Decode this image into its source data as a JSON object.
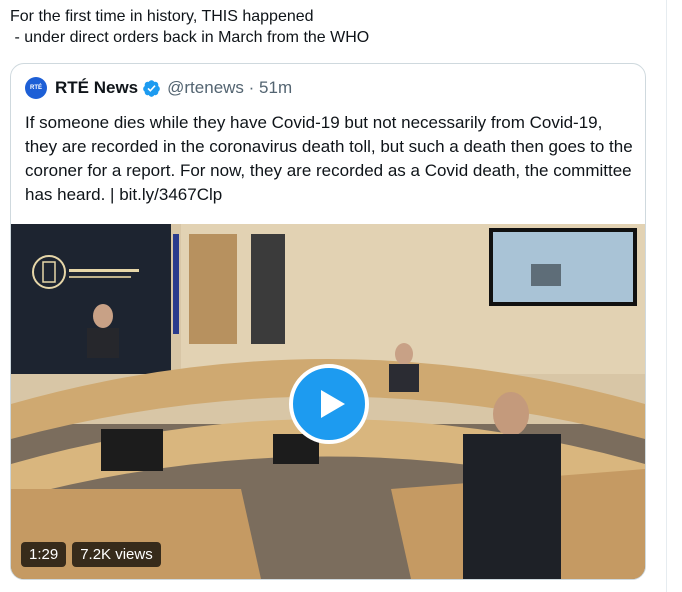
{
  "tweet": {
    "text_lines": [
      "For the first time in history, THIS happened",
      " - under direct orders back in March from the WHO"
    ]
  },
  "quote": {
    "avatar_text": "RTÉ",
    "display_name": "RTÉ News",
    "verified_icon": "verified-badge-icon",
    "handle_time": "@rtenews · 51m",
    "body": "If someone dies while they have Covid-19 but not necessarily from Covid-19, they are recorded in the coronavirus death toll, but such a death then goes to the coroner for a report. For now, they are recorded as a Covid death, the committee has heard. | bit.ly/3467Clp"
  },
  "video": {
    "duration": "1:29",
    "views": "7.2K views",
    "play_icon": "play-icon",
    "accent_color": "#1d9bf0"
  }
}
